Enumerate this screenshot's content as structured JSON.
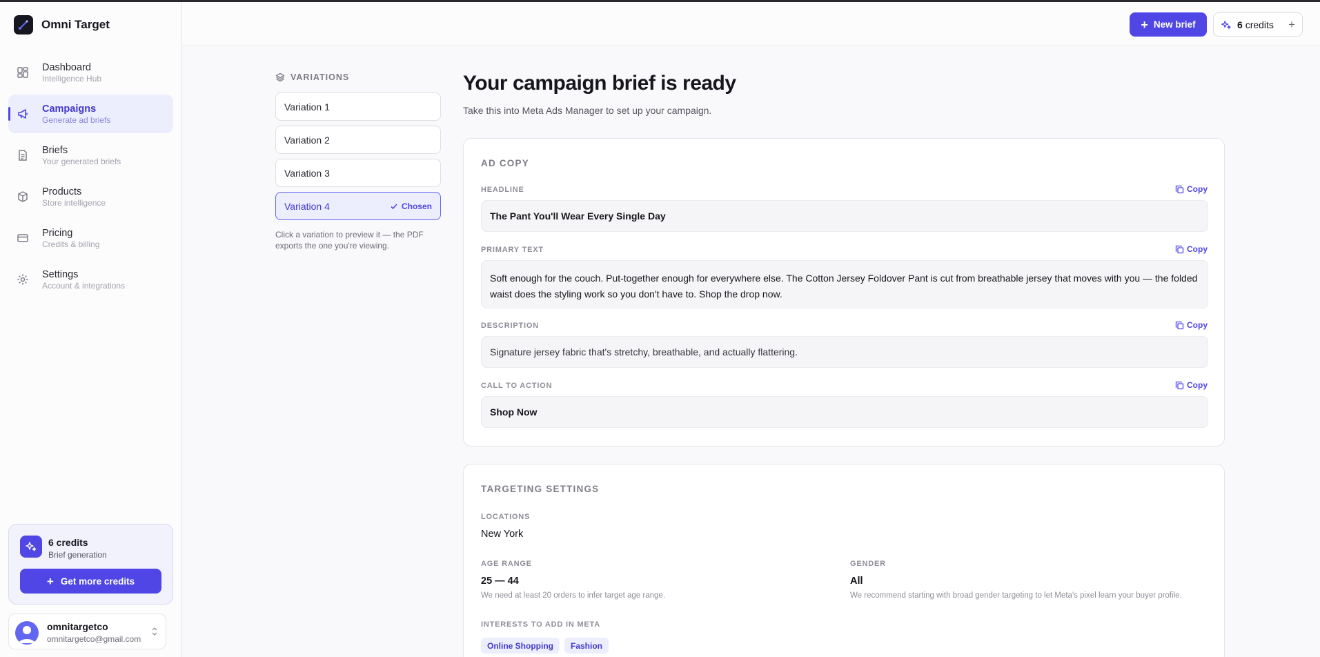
{
  "app": {
    "name": "Omni Target"
  },
  "sidebar": {
    "items": [
      {
        "label": "Dashboard",
        "sub": "Intelligence Hub",
        "icon": "dashboard-grid-icon"
      },
      {
        "label": "Campaigns",
        "sub": "Generate ad briefs",
        "icon": "megaphone-icon",
        "active": true
      },
      {
        "label": "Briefs",
        "sub": "Your generated briefs",
        "icon": "document-icon"
      },
      {
        "label": "Products",
        "sub": "Store intelligence",
        "icon": "box-icon"
      },
      {
        "label": "Pricing",
        "sub": "Credits & billing",
        "icon": "credit-card-icon"
      },
      {
        "label": "Settings",
        "sub": "Account & integrations",
        "icon": "gear-icon"
      }
    ],
    "credits_card": {
      "title": "6 credits",
      "sub": "Brief generation",
      "button": "Get more credits"
    },
    "user": {
      "name": "omnitargetco",
      "email": "omnitargetco@gmail.com"
    }
  },
  "topbar": {
    "new_brief": "New brief",
    "credits_count": "6",
    "credits_word": "credits"
  },
  "variations": {
    "heading": "VARIATIONS",
    "items": [
      "Variation 1",
      "Variation 2",
      "Variation 3",
      "Variation 4"
    ],
    "chosen_index": 3,
    "chosen_label": "Chosen",
    "note": "Click a variation to preview it — the PDF exports the one you're viewing."
  },
  "main": {
    "title": "Your campaign brief is ready",
    "subtitle": "Take this into Meta Ads Manager to set up your campaign."
  },
  "ad_copy": {
    "title": "AD COPY",
    "copy_label": "Copy",
    "headline_label": "HEADLINE",
    "headline": "The Pant You'll Wear Every Single Day",
    "primary_label": "PRIMARY TEXT",
    "primary_text": "Soft enough for the couch. Put-together enough for everywhere else. The Cotton Jersey Foldover Pant is cut from breathable jersey that moves with you — the folded waist does the styling work so you don't have to. Shop the drop now.",
    "description_label": "DESCRIPTION",
    "description": "Signature jersey fabric that's stretchy, breathable, and actually flattering.",
    "cta_label": "CALL TO ACTION",
    "cta": "Shop Now"
  },
  "targeting": {
    "title": "TARGETING SETTINGS",
    "locations_label": "LOCATIONS",
    "locations": "New York",
    "age_label": "AGE RANGE",
    "age": "25 — 44",
    "age_note": "We need at least 20 orders to infer target age range.",
    "gender_label": "GENDER",
    "gender": "All",
    "gender_note": "We recommend starting with broad gender targeting to let Meta's pixel learn your buyer profile.",
    "interests_label": "INTERESTS TO ADD IN META",
    "interests": [
      "Online Shopping",
      "Fashion"
    ]
  },
  "colors": {
    "accent": "#4f46e5",
    "accent_soft": "#eceefe"
  }
}
